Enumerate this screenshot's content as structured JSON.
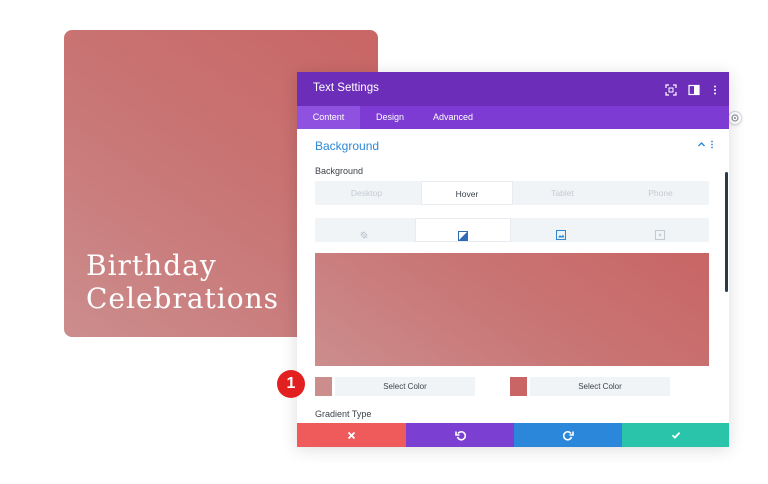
{
  "preview": {
    "title": "Birthday\nCelebrations",
    "gradient": {
      "start": "#cc8d8d",
      "end": "#c96565"
    }
  },
  "panel": {
    "title": "Text Settings",
    "header_icons": [
      "expand-icon",
      "split-view-icon",
      "more-options-icon"
    ],
    "tabs": [
      {
        "label": "Content",
        "active": true
      },
      {
        "label": "Design",
        "active": false
      },
      {
        "label": "Advanced",
        "active": false
      }
    ],
    "section": {
      "title": "Background",
      "collapse_icon": "chevron-up-icon",
      "menu_icon": "kebab-icon"
    },
    "background_label": "Background",
    "device_tabs": [
      {
        "label": "Desktop",
        "active": false
      },
      {
        "label": "Hover",
        "active": true
      },
      {
        "label": "Tablet",
        "active": false
      },
      {
        "label": "Phone",
        "active": false
      }
    ],
    "bg_type_tabs": [
      {
        "icon": "color-fill-icon",
        "active": false
      },
      {
        "icon": "gradient-icon",
        "active": true
      },
      {
        "icon": "image-icon",
        "active": false
      },
      {
        "icon": "video-icon",
        "active": false
      }
    ],
    "gradient_stops": [
      {
        "color": "#cc8d8d",
        "label": "Select Color"
      },
      {
        "color": "#c96565",
        "label": "Select Color"
      }
    ],
    "gradient_type_label": "Gradient Type",
    "footer_buttons": [
      {
        "name": "cancel-button",
        "icon": "close-icon",
        "color": "#ef5a5a"
      },
      {
        "name": "undo-button",
        "icon": "undo-icon",
        "color": "#7b3fd1"
      },
      {
        "name": "redo-button",
        "icon": "redo-icon",
        "color": "#2b87da"
      },
      {
        "name": "save-button",
        "icon": "check-icon",
        "color": "#29c4a9"
      }
    ]
  },
  "annotation": {
    "step": "1",
    "color": "#e32020"
  }
}
